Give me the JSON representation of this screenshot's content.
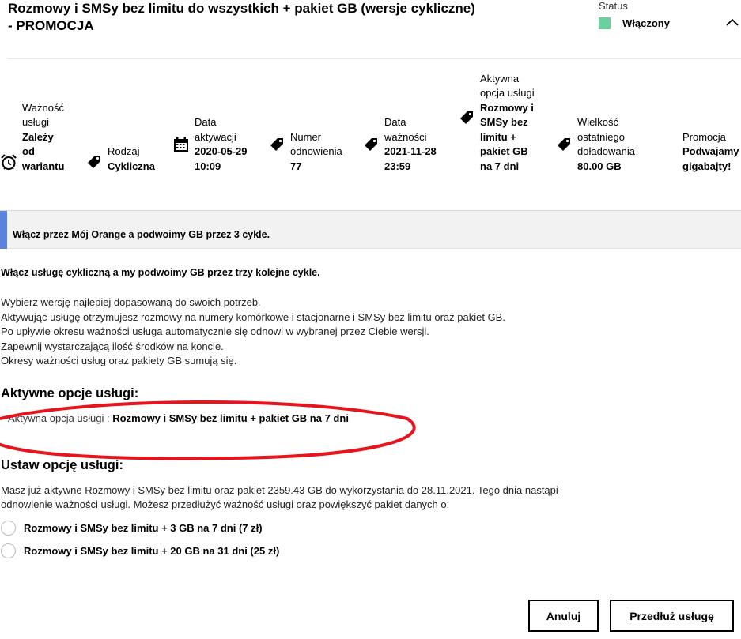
{
  "header": {
    "title": "Rozmowy i SMSy bez limitu do wszystkich + pakiet GB (wersje cykliczne) - PROMOCJA",
    "status_label": "Status",
    "status_value": "Włączony",
    "status_color": "#6ccf9e"
  },
  "info": {
    "validity": {
      "label_lines": [
        "Ważność",
        "usługi"
      ],
      "value_lines": [
        "Zależy",
        "od",
        "wariantu"
      ],
      "icon": "alarm-clock-icon"
    },
    "type": {
      "label_lines": [
        "Rodzaj"
      ],
      "value_lines": [
        "Cykliczna"
      ],
      "icon": "tag-icon"
    },
    "activation": {
      "label_lines": [
        "Data",
        "aktywacji"
      ],
      "value_lines": [
        "2020-05-29",
        "10:09"
      ],
      "icon": "calendar-icon"
    },
    "renewal": {
      "label_lines": [
        "Numer",
        "odnowienia"
      ],
      "value_lines": [
        "77"
      ],
      "icon": "tag-icon"
    },
    "expiry": {
      "label_lines": [
        "Data",
        "ważności"
      ],
      "value_lines": [
        "2021-11-28",
        "23:59"
      ],
      "icon": "tag-icon"
    },
    "active_option": {
      "label_lines": [
        "Aktywna",
        "opcja usługi"
      ],
      "value_lines": [
        "Rozmowy i",
        "SMSy bez",
        "limitu +",
        "pakiet GB",
        "na 7 dni"
      ],
      "icon": "tag-icon"
    },
    "last_topup": {
      "label_lines": [
        "Wielkość",
        "ostatniego",
        "doładowania"
      ],
      "value_lines": [
        "80.00 GB"
      ],
      "icon": "tag-icon"
    },
    "promo": {
      "label_lines": [
        "Promocja"
      ],
      "value_lines": [
        "Podwajamy",
        "gigabajty!"
      ]
    }
  },
  "banner": {
    "text": "Włącz przez Mój Orange a podwoimy GB przez 3 cykle.",
    "accent_color": "#5b82dd"
  },
  "content": {
    "lead": "Włącz usługę cykliczną a my podwoimy GB przez trzy kolejne cykle.",
    "desc_lines": [
      "Wybierz wersję najlepiej dopasowaną do swoich potrzeb.",
      "Aktywując usługę otrzymujesz rozmowy na numery komórkowe i stacjonarne i SMSy bez limitu oraz pakiet GB.",
      "Po upływie okresu ważności usługa automatycznie się odnowi w wybranej przez Ciebie wersji.",
      "Zapewnij wystarczającą ilość środków na koncie.",
      "Okresy ważności usług oraz pakiety GB sumują się."
    ]
  },
  "active_options": {
    "heading": "Aktywne opcje usługi:",
    "label": "Aktywna opcja usługi : ",
    "value": "Rozmowy i SMSy bez limitu + pakiet GB na 7 dni",
    "annotation_color": "#e8141c"
  },
  "set_option": {
    "heading": "Ustaw opcję usługi:",
    "info": "Masz już aktywne Rozmowy i SMSy bez limitu oraz pakiet 2359.43 GB do wykorzystania do 28.11.2021. Tego dnia nastąpi odnowienie ważności usługi. Możesz przedłużyć ważność usługi oraz powiększyć pakiet danych o:",
    "options": [
      {
        "label": "Rozmowy i SMSy bez limitu + 3 GB na 7 dni (7 zł)"
      },
      {
        "label": "Rozmowy i SMSy bez limitu + 20 GB na 31 dni (25 zł)"
      }
    ]
  },
  "buttons": {
    "cancel": "Anuluj",
    "extend": "Przedłuż usługę"
  }
}
